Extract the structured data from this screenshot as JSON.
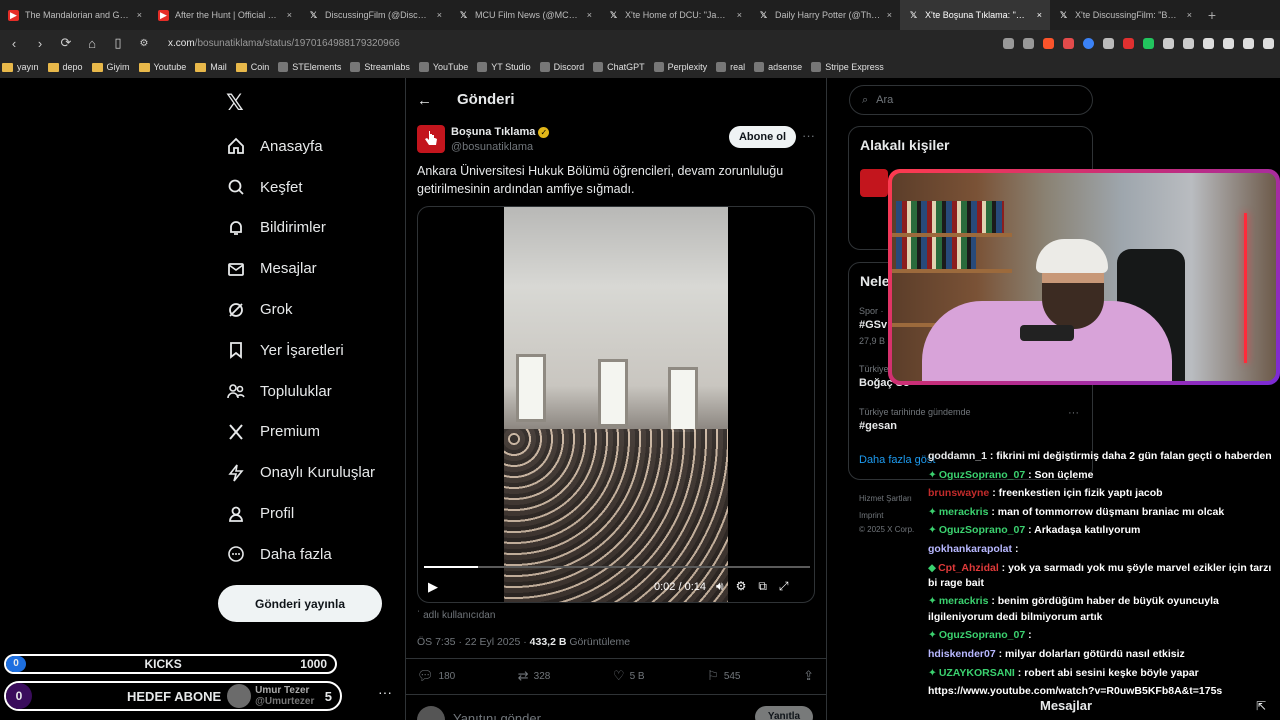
{
  "browser": {
    "tabs": [
      {
        "title": "The Mandalorian and Grogu | Official",
        "icon": "youtube-icon",
        "active": false
      },
      {
        "title": "After the Hunt | Official Trailer",
        "icon": "youtube-icon",
        "active": false
      },
      {
        "title": "DiscussingFilm (@DiscussingFil",
        "icon": "x-icon",
        "active": false
      },
      {
        "title": "MCU Film News (@MCUFilmN",
        "icon": "x-icon",
        "active": false
      },
      {
        "title": "X'te Home of DCU: \"James Gu",
        "icon": "x-icon",
        "active": false
      },
      {
        "title": "Daily Harry Potter (@TheDaily",
        "icon": "x-icon",
        "active": false
      },
      {
        "title": "X'te Boşuna Tıklama: \"Ank",
        "icon": "x-icon",
        "active": true
      },
      {
        "title": "X'te DiscussingFilm: \"Ben Whe",
        "icon": "x-icon",
        "active": false
      }
    ],
    "new_tab": "+",
    "url_host": "x.com",
    "url_path": "/bosunatiklama/status/1970164988179320966",
    "bookmarks": [
      {
        "label": "yayın",
        "type": "folder"
      },
      {
        "label": "depo",
        "type": "folder"
      },
      {
        "label": "Giyim",
        "type": "folder"
      },
      {
        "label": "Youtube",
        "type": "folder"
      },
      {
        "label": "Mail",
        "type": "folder"
      },
      {
        "label": "Coin",
        "type": "folder"
      },
      {
        "label": "STElements",
        "type": "site"
      },
      {
        "label": "Streamlabs",
        "type": "site"
      },
      {
        "label": "YouTube",
        "type": "site"
      },
      {
        "label": "YT Studio",
        "type": "site"
      },
      {
        "label": "Discord",
        "type": "site"
      },
      {
        "label": "ChatGPT",
        "type": "site"
      },
      {
        "label": "Perplexity",
        "type": "site"
      },
      {
        "label": "real",
        "type": "site"
      },
      {
        "label": "adsense",
        "type": "site"
      },
      {
        "label": "Stripe Express",
        "type": "site"
      }
    ]
  },
  "sidebar": {
    "items": [
      {
        "label": "Anasayfa",
        "icon": "home-icon"
      },
      {
        "label": "Keşfet",
        "icon": "search-icon"
      },
      {
        "label": "Bildirimler",
        "icon": "bell-icon"
      },
      {
        "label": "Mesajlar",
        "icon": "mail-icon"
      },
      {
        "label": "Grok",
        "icon": "grok-icon"
      },
      {
        "label": "Yer İşaretleri",
        "icon": "bookmark-icon"
      },
      {
        "label": "Topluluklar",
        "icon": "people-icon"
      },
      {
        "label": "Premium",
        "icon": "x-icon"
      },
      {
        "label": "Onaylı Kuruluşlar",
        "icon": "bolt-icon"
      },
      {
        "label": "Profil",
        "icon": "person-icon"
      },
      {
        "label": "Daha fazla",
        "icon": "more-circle-icon"
      }
    ],
    "post_button": "Gönderi yayınla"
  },
  "overlay": {
    "kicks_current": "0",
    "kicks_label": "KICKS",
    "kicks_goal": "1000",
    "sub_current": "0",
    "sub_label": "HEDEF ABONE",
    "sub_user": "Umur Tezer",
    "sub_handle": "@Umurtezer",
    "sub_goal": "5"
  },
  "post": {
    "header_title": "Gönderi",
    "author_name": "Boşuna Tıklama",
    "author_handle": "@bosunatiklama",
    "follow_label": "Abone ol",
    "text": "Ankara Üniversitesi Hukuk Bölümü öğrencileri, devam zorunluluğu getirilmesinin ardından amfiye sığmadı.",
    "video_time": "0:02 / 0:14",
    "video_progress": 0.14,
    "source_note": "adlı kullanıcıdan",
    "time": "ÖS 7:35 · 22 Eyl 2025 ·",
    "views": "433,2 B",
    "views_label": "Görüntüleme",
    "replies": "180",
    "reposts": "328",
    "likes": "5 B",
    "bookmarks": "545",
    "reply_placeholder": "Yanıtını gönder",
    "reply_button": "Yanıtla"
  },
  "right": {
    "search_placeholder": "Ara",
    "related_title": "Alakalı kişiler",
    "trends_title": "Nele",
    "trends": [
      {
        "context": "Spor ·",
        "name": "#GSv",
        "count": "27,9 B"
      },
      {
        "context": "Türkiye",
        "name": "Boğaç So",
        "count": ""
      },
      {
        "context": "Türkiye tarihinde gündemde",
        "name": "#gesan",
        "count": ""
      }
    ],
    "show_more": "Daha fazla göst",
    "footer": [
      "Hizmet Şartları",
      "Imprint",
      "© 2025 X Corp."
    ]
  },
  "chat": [
    {
      "user": "goddamn_1",
      "text": ": fikrini mi değiştirmiş daha 2 gün falan geçti o haberden",
      "color": "#e7e9ea",
      "badge": ""
    },
    {
      "user": "OguzSoprano_07",
      "text": ": Son üçleme",
      "color": "#3bd16f",
      "badge": "✦"
    },
    {
      "user": "brunswayne",
      "text": ": freenkestien için fizik yaptı jacob",
      "color": "#c22b2b",
      "badge": ""
    },
    {
      "user": "merackris",
      "text": ": man of tommorrow düşmanı braniac mı olcak",
      "color": "#3bd16f",
      "badge": "✦"
    },
    {
      "user": "OguzSoprano_07",
      "text": ": Arkadaşa katılıyorum",
      "color": "#3bd16f",
      "badge": "✦"
    },
    {
      "user": "gokhankarapolat",
      "text": ":",
      "color": "#b8b8ff",
      "badge": ""
    },
    {
      "user": "Cpt_Ahzidal",
      "text": ": yok ya sarmadı yok mu şöyle marvel ezikler için tarzı bi rage bait",
      "color": "#e03a3a",
      "badge": "◆"
    },
    {
      "user": "merackris",
      "text": ": benim gördüğüm haber de büyük oyuncuyla ilgileniyorum dedi bilmiyorum artık",
      "color": "#3bd16f",
      "badge": "✦"
    },
    {
      "user": "OguzSoprano_07",
      "text": ":",
      "color": "#3bd16f",
      "badge": "✦"
    },
    {
      "user": "hdiskender07",
      "text": ": milyar dolarları götürdü nasıl etkisiz",
      "color": "#b8b8ff",
      "badge": ""
    },
    {
      "user": "UZAYKORSANI",
      "text": ": robert abi sesini keşke böyle yapar",
      "color": "#3bd16f",
      "badge": "✦"
    },
    {
      "user": "",
      "text": "https://www.youtube.com/watch?v=R0uwB5KFb8A&t=175s",
      "color": "#e7e9ea",
      "badge": ""
    }
  ],
  "dock": {
    "messages_label": "Mesajlar"
  }
}
